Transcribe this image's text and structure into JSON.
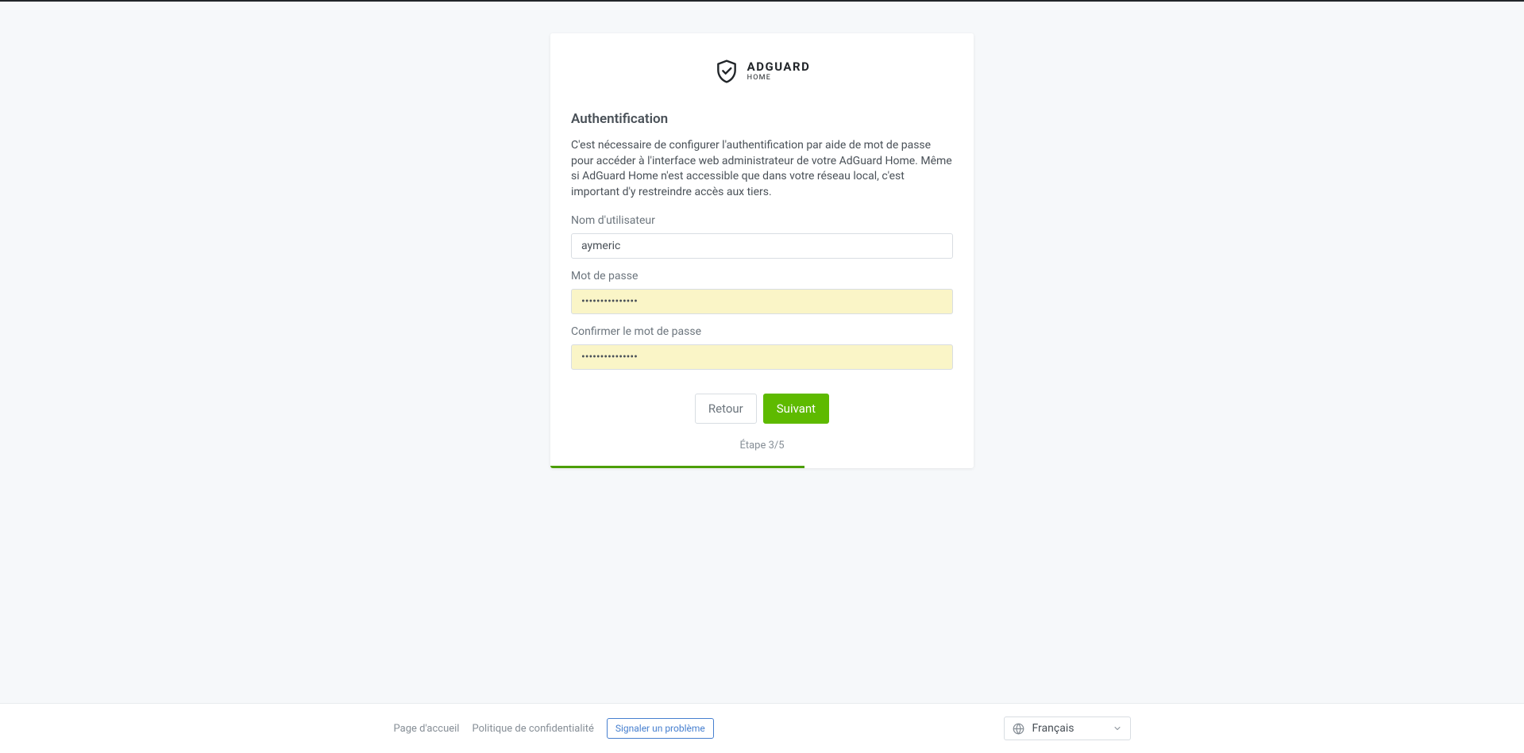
{
  "logo": {
    "brand": "ADGUARD",
    "sub": "HOME"
  },
  "heading": "Authentification",
  "description": "C'est nécessaire de configurer l'authentification par aide de mot de passe pour accéder à l'interface web administrateur de votre AdGuard Home. Même si AdGuard Home n'est accessible que dans votre réseau local, c'est important d'y restreindre accès aux tiers.",
  "fields": {
    "username": {
      "label": "Nom d'utilisateur",
      "value": "aymeric"
    },
    "password": {
      "label": "Mot de passe",
      "value": "•••••••••••••••"
    },
    "confirm": {
      "label": "Confirmer le mot de passe",
      "value": "•••••••••••••••"
    }
  },
  "buttons": {
    "back": "Retour",
    "next": "Suivant"
  },
  "step": {
    "text": "Étape 3/5",
    "current": 3,
    "total": 5
  },
  "footer": {
    "home": "Page d'accueil",
    "privacy": "Politique de confidentialité",
    "report": "Signaler un problème",
    "language": "Français"
  },
  "colors": {
    "accent": "#5eba00",
    "link": "#467fcf"
  }
}
